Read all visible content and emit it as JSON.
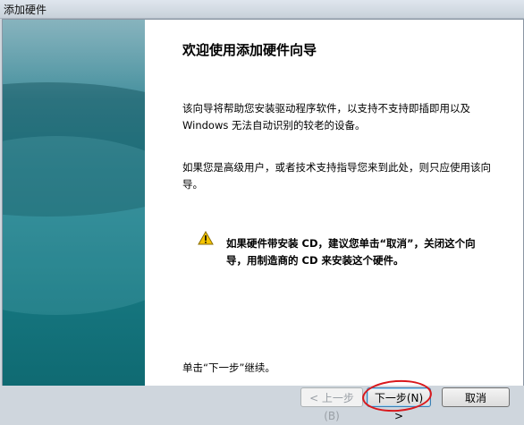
{
  "window": {
    "title": "添加硬件"
  },
  "page": {
    "heading": "欢迎使用添加硬件向导",
    "paragraph1": "该向导将帮助您安装驱动程序软件，以支持不支持即插即用以及 Windows 无法自动识别的较老的设备。",
    "paragraph2": "如果您是高级用户，或者技术支持指导您来到此处，则只应使用该向导。",
    "warning": "如果硬件带安装 CD，建议您单击“取消”，关闭这个向导，用制造商的 CD 来安装这个硬件。",
    "instruction": "单击“下一步”继续。"
  },
  "buttons": {
    "back": "< 上一步(B)",
    "next": "下一步(N) >",
    "cancel": "取消"
  },
  "colors": {
    "sidebar": "#16767f",
    "annotation": "#d9181c",
    "warning_icon": "#f5c400"
  },
  "icons": {
    "warning": "warning-icon"
  }
}
